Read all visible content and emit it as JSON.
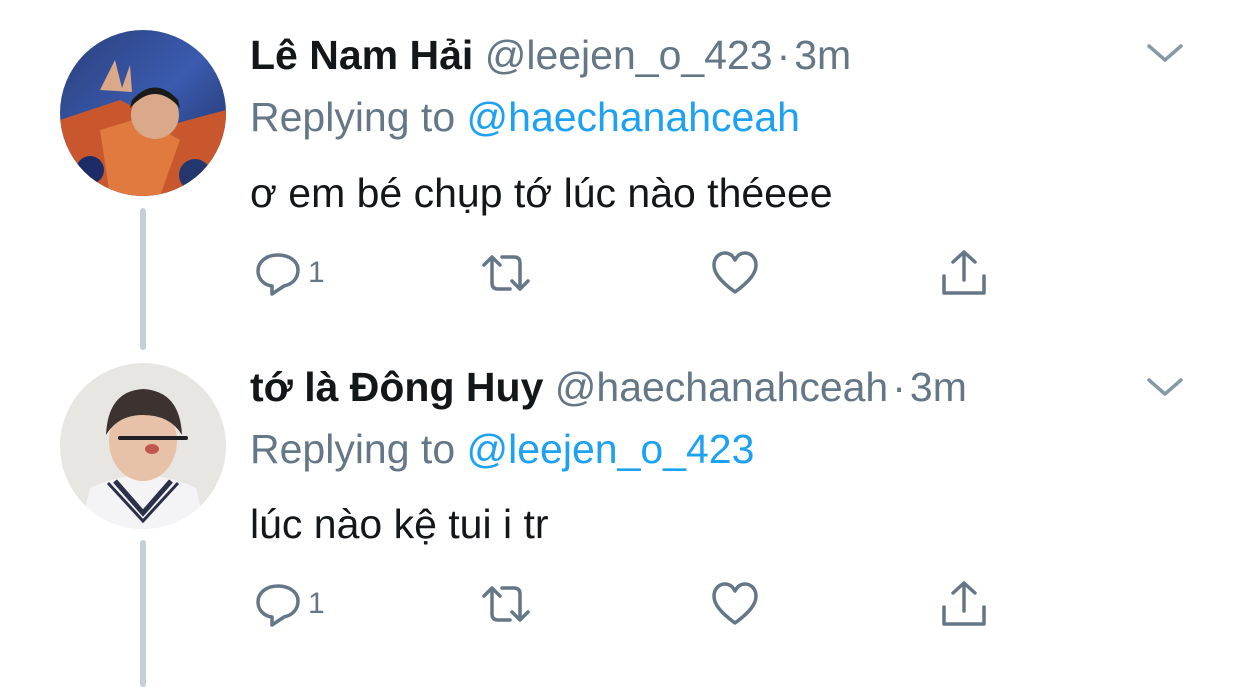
{
  "tweets": [
    {
      "name": "Lê Nam Hải",
      "handle": "@leejen_o_423",
      "dot": "·",
      "time": "3m",
      "replying_prefix": "Replying to ",
      "replying_to": "@haechanahceah",
      "text": "ơ em bé chụp tớ lúc nào théeee",
      "reply_count": "1",
      "avatar_icon": "avatar-photo"
    },
    {
      "name": "tớ là Đông Huy",
      "handle": "@haechanahceah",
      "dot": "·",
      "time": "3m",
      "replying_prefix": "Replying to ",
      "replying_to": "@leejen_o_423",
      "text": "lúc nào kệ tui i tr",
      "reply_count": "1",
      "avatar_icon": "avatar-photo"
    }
  ],
  "icons": {
    "reply": "reply-icon",
    "retweet": "retweet-icon",
    "like": "heart-icon",
    "share": "share-icon",
    "menu": "chevron-down-icon"
  },
  "colors": {
    "text": "#14171a",
    "muted": "#657786",
    "link": "#1da1f2",
    "thread_line": "#c4cfd6"
  }
}
